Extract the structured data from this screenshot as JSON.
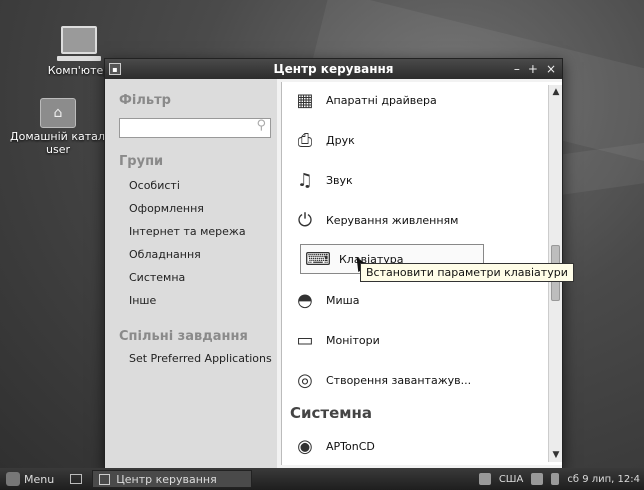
{
  "desktop": {
    "icons": [
      {
        "label": "Комп'ютер",
        "icon": "computer-icon"
      },
      {
        "label": "Домашній каталог",
        "sublabel": "user",
        "icon": "home-folder-icon"
      }
    ]
  },
  "window": {
    "title": "Центр керування",
    "buttons": {
      "minimize": "–",
      "maximize": "+",
      "close": "×"
    }
  },
  "sidebar": {
    "filter_heading": "Фільтр",
    "search": {
      "value": "",
      "placeholder": ""
    },
    "groups_heading": "Групи",
    "groups": [
      "Особисті",
      "Оформлення",
      "Інтернет та мережа",
      "Обладнання",
      "Системна",
      "Інше"
    ],
    "tasks_heading": "Спільні завдання",
    "tasks": [
      "Set Preferred Applications"
    ]
  },
  "content": {
    "items": [
      {
        "label": "Апаратні драйвера",
        "icon": "hardware-drivers-icon"
      },
      {
        "label": "Друк",
        "icon": "printer-icon"
      },
      {
        "label": "Звук",
        "icon": "sound-icon"
      },
      {
        "label": "Керування живленням",
        "icon": "power-management-icon"
      },
      {
        "label": "Клавіатура",
        "icon": "keyboard-icon"
      },
      {
        "label": "Миша",
        "icon": "mouse-icon"
      },
      {
        "label": "Монітори",
        "icon": "monitor-icon"
      },
      {
        "label": "Створення завантажув...",
        "icon": "startup-disk-icon"
      }
    ],
    "section_heading": "Системна",
    "section_items": [
      {
        "label": "APTonCD",
        "icon": "aptoncd-icon"
      }
    ],
    "tooltip": "Встановити параметри клавіатури"
  },
  "taskbar": {
    "menu_label": "Menu",
    "task_label": "Центр керування",
    "keyboard_layout": "США",
    "clock": "сб 9 лип, 12:4"
  }
}
